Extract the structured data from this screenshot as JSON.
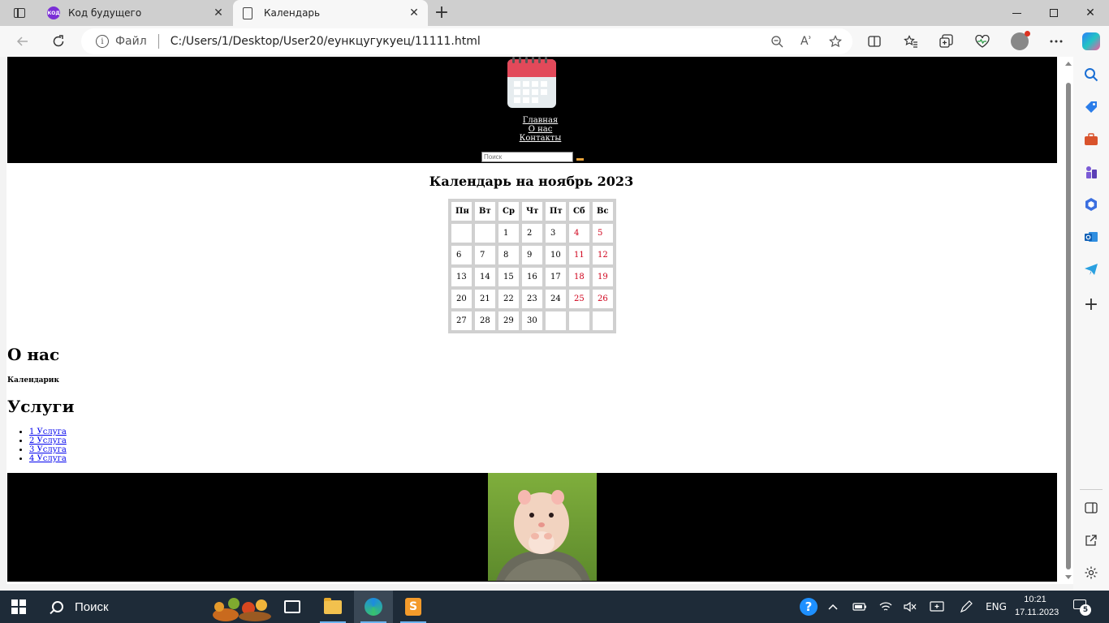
{
  "browser": {
    "tabs": [
      {
        "title": "Код будущего",
        "favicon": "kod-logo-icon",
        "favicon_text": "КОД",
        "active": false
      },
      {
        "title": "Календарь",
        "favicon": "document-icon",
        "active": true
      }
    ],
    "new_tab_symbol": "+",
    "close_symbol": "✕",
    "address": {
      "file_label": "Файл",
      "url": "C:/Users/1/Desktop/User20/еункцугукуец/11111.html"
    },
    "read_aloud": "Aʾ"
  },
  "page": {
    "nav": [
      "Главная",
      "О нас",
      "Контакты"
    ],
    "search_placeholder": "Поиск",
    "calendar": {
      "title": "Календарь на ноябрь 2023",
      "weekdays": [
        "Пн",
        "Вт",
        "Ср",
        "Чт",
        "Пт",
        "Сб",
        "Вс"
      ],
      "weeks": [
        [
          "",
          "",
          "1",
          "2",
          "3",
          "4",
          "5"
        ],
        [
          "6",
          "7",
          "8",
          "9",
          "10",
          "11",
          "12"
        ],
        [
          "13",
          "14",
          "15",
          "16",
          "17",
          "18",
          "19"
        ],
        [
          "20",
          "21",
          "22",
          "23",
          "24",
          "25",
          "26"
        ],
        [
          "27",
          "28",
          "29",
          "30",
          "",
          "",
          ""
        ]
      ],
      "weekend_color": "#d0021b"
    },
    "about": {
      "heading": "О нас",
      "text": "Календарик"
    },
    "services": {
      "heading": "Услуги",
      "items": [
        "1 Услуга",
        "2 Услуга",
        "3 Услуга",
        "4 Услуга"
      ]
    },
    "header_bg": "#000000",
    "footer_bg": "#000000"
  },
  "taskbar": {
    "search_label": "Поиск",
    "language": "ENG",
    "time": "10:21",
    "date": "17.11.2023",
    "notification_count": "5"
  }
}
